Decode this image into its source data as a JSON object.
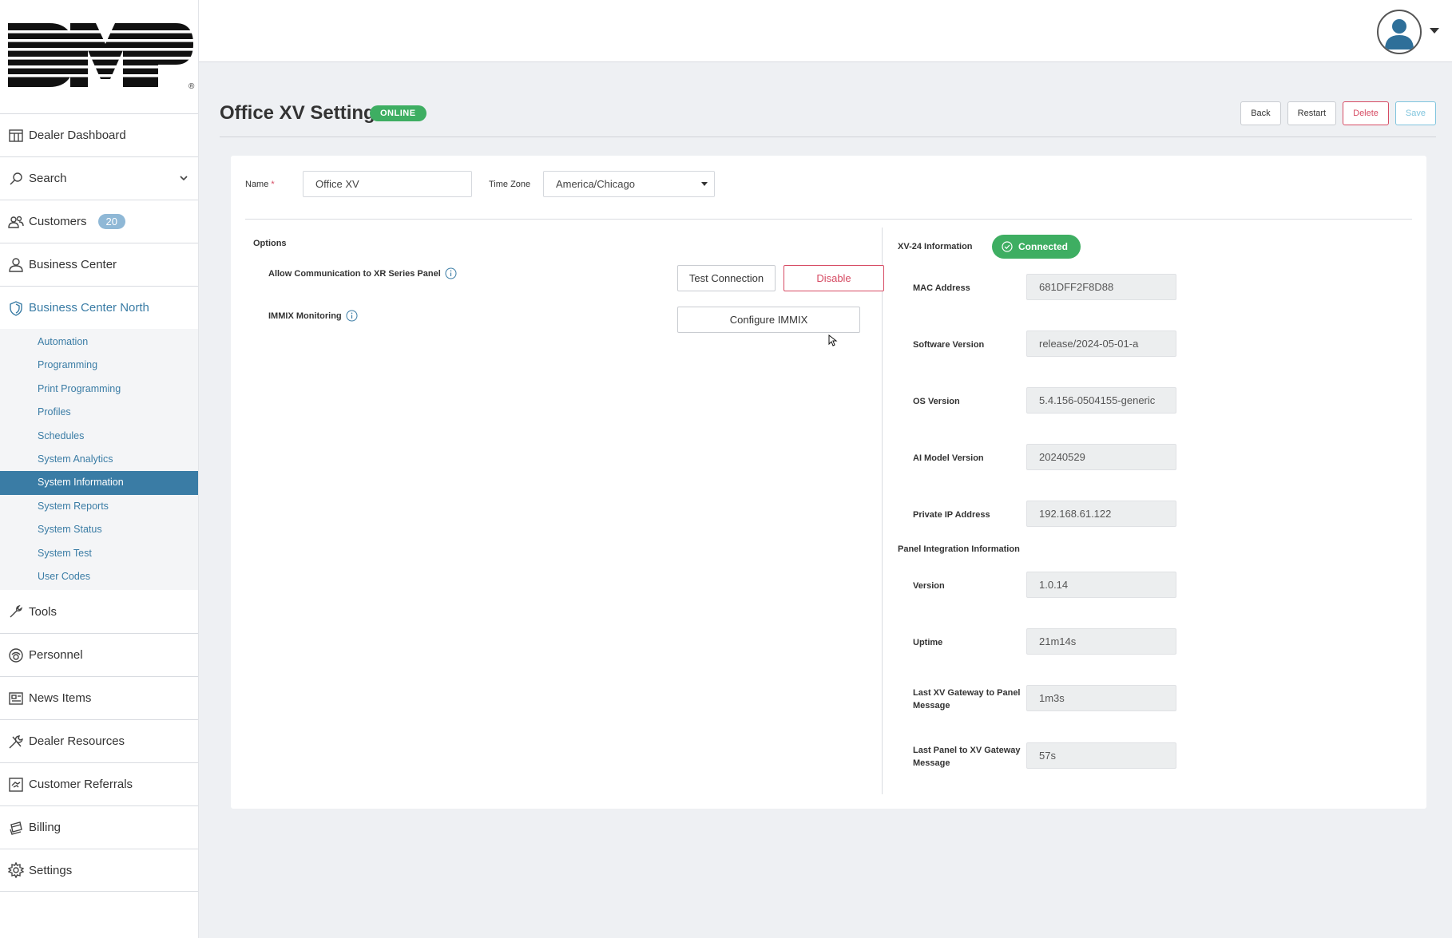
{
  "brand": {
    "logo_text": "DMP",
    "registered": "®"
  },
  "sidebar": {
    "items": [
      {
        "label": "Dealer Dashboard",
        "icon": "dashboard-icon"
      },
      {
        "label": "Search",
        "icon": "search-icon"
      },
      {
        "label": "Customers",
        "icon": "customers-icon",
        "badge": "20"
      },
      {
        "label": "Business Center",
        "icon": "business-center-icon"
      },
      {
        "label": "Business Center North",
        "icon": "shield-icon"
      }
    ],
    "subitems": [
      "Automation",
      "Programming",
      "Print Programming",
      "Profiles",
      "Schedules",
      "System Analytics",
      "System Information",
      "System Reports",
      "System Status",
      "System Test",
      "User Codes"
    ],
    "selected_subitem": "System Information",
    "bottom_items": [
      {
        "label": "Tools",
        "icon": "wrench-icon"
      },
      {
        "label": "Personnel",
        "icon": "personnel-icon"
      },
      {
        "label": "News Items",
        "icon": "newspaper-icon"
      },
      {
        "label": "Dealer Resources",
        "icon": "tools-icon"
      },
      {
        "label": "Customer Referrals",
        "icon": "handshake-icon"
      },
      {
        "label": "Billing",
        "icon": "billing-icon"
      },
      {
        "label": "Settings",
        "icon": "gear-icon"
      }
    ]
  },
  "header": {
    "title": "Office XV Settings",
    "status": "ONLINE",
    "actions": {
      "back": "Back",
      "restart": "Restart",
      "delete": "Delete",
      "save": "Save"
    }
  },
  "form": {
    "name_label": "Name",
    "required_mark": "*",
    "name_value": "Office XV",
    "timezone_label": "Time Zone",
    "timezone_value": "America/Chicago"
  },
  "options": {
    "title": "Options",
    "allow_comm_label": "Allow Communication to XR Series Panel",
    "test_connection": "Test Connection",
    "disable": "Disable",
    "immix_label": "IMMIX Monitoring",
    "configure_immix": "Configure IMMIX"
  },
  "xv_info": {
    "title": "XV-24 Information",
    "connection_status": "Connected",
    "fields": [
      {
        "label": "MAC Address",
        "value": "681DFF2F8D88"
      },
      {
        "label": "Software Version",
        "value": "release/2024-05-01-a"
      },
      {
        "label": "OS Version",
        "value": "5.4.156-0504155-generic"
      },
      {
        "label": "AI Model Version",
        "value": "20240529"
      },
      {
        "label": "Private IP Address",
        "value": "192.168.61.122"
      }
    ]
  },
  "panel_integration": {
    "title": "Panel Integration Information",
    "fields": [
      {
        "label": "Version",
        "value": "1.0.14"
      },
      {
        "label": "Uptime",
        "value": "21m14s"
      },
      {
        "label": "Last XV Gateway to Panel Message",
        "value": "1m3s"
      },
      {
        "label": "Last Panel to XV Gateway Message",
        "value": "57s"
      }
    ]
  },
  "colors": {
    "accent": "#3a7ca5",
    "online": "#3eae62",
    "danger": "#d64b63",
    "save": "#7fc4dd"
  }
}
